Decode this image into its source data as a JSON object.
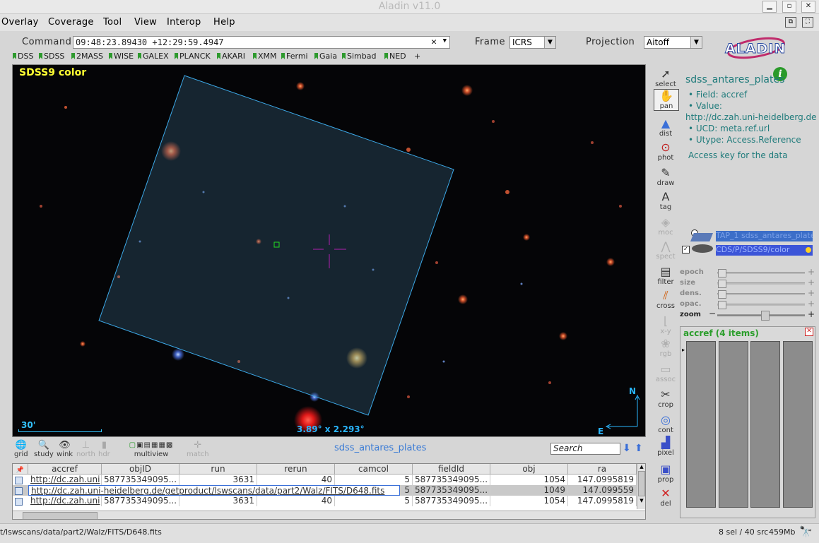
{
  "window": {
    "title": "Aladin v11.0"
  },
  "menu": [
    "Overlay",
    "Coverage",
    "Tool",
    "View",
    "Interop",
    "Help"
  ],
  "command": {
    "label": "Command",
    "value": "09:48:23.89430 +12:29:59.4947"
  },
  "frame": {
    "label": "Frame",
    "value": "ICRS"
  },
  "projection": {
    "label": "Projection",
    "value": "Aitoff"
  },
  "logo": "ALADIN",
  "bookmarks": [
    "DSS",
    "SDSS",
    "2MASS",
    "WISE",
    "GALEX",
    "PLANCK",
    "AKARI",
    "XMM",
    "Fermi",
    "Gaia",
    "Simbad",
    "NED",
    "+"
  ],
  "view": {
    "survey": "SDSS9 color",
    "fov": "3.89° x 2.293°",
    "scale": "30'",
    "north": "N",
    "east": "E"
  },
  "tools": {
    "select": "select",
    "pan": "pan",
    "dist": "dist",
    "phot": "phot",
    "draw": "draw",
    "tag": "tag",
    "moc": "moc",
    "spect": "spect",
    "filter": "filter",
    "cross": "cross",
    "xy": "x-y",
    "rgb": "rgb",
    "assoc": "assoc",
    "crop": "crop",
    "cont": "cont",
    "pixel": "pixel",
    "prop": "prop",
    "del": "del"
  },
  "info": {
    "title": "sdss_antares_plates",
    "field": "• Field: accref",
    "value": "• Value:",
    "url": "http://dc.zah.uni-heidelberg.de",
    "ucd": "• UCD: meta.ref.url",
    "utype": "• Utype: Access.Reference",
    "desc": "Access key for the data"
  },
  "stack": {
    "plane1": "TAP_1 sdss_antares_plates",
    "plane2": "CDS/P/SDSS9/color"
  },
  "sliders": {
    "epoch": "epoch",
    "size": "size",
    "dens": "dens.",
    "opac": "opac.",
    "zoom": "zoom",
    "zoom_level": 0.55
  },
  "accref_panel": {
    "title": "accref (4 items)"
  },
  "bottom_tools": {
    "grid": "grid",
    "study": "study",
    "wink": "wink",
    "north": "north",
    "hdr": "hdr",
    "multiview": "multiview",
    "match": "match"
  },
  "plane_name": "sdss_antares_plates",
  "search": {
    "placeholder": "Search"
  },
  "table": {
    "columns": [
      "accref",
      "objID",
      "run",
      "rerun",
      "camcol",
      "fieldId",
      "obj",
      "ra"
    ],
    "rows": [
      [
        "http://dc.zah.uni",
        "587735349095...",
        "3631",
        "40",
        "5",
        "587735349095...",
        "1054",
        "147.0995819"
      ],
      [
        "http://dc.zah.uni-heidelberg.de/getproduct/lswscans/data/part2/Walz/FITS/D648.fits",
        "",
        "",
        "",
        "5",
        "587735349095...",
        "1049",
        "147.099559"
      ],
      [
        "http://dc.zah.uni",
        "587735349095...",
        "3631",
        "40",
        "5",
        "587735349095...",
        "1054",
        "147.0995819"
      ]
    ]
  },
  "status": {
    "left": "t/lswscans/data/part2/Walz/FITS/D648.fits",
    "sel": "8 sel / 40 src",
    "mem": "459Mb"
  }
}
